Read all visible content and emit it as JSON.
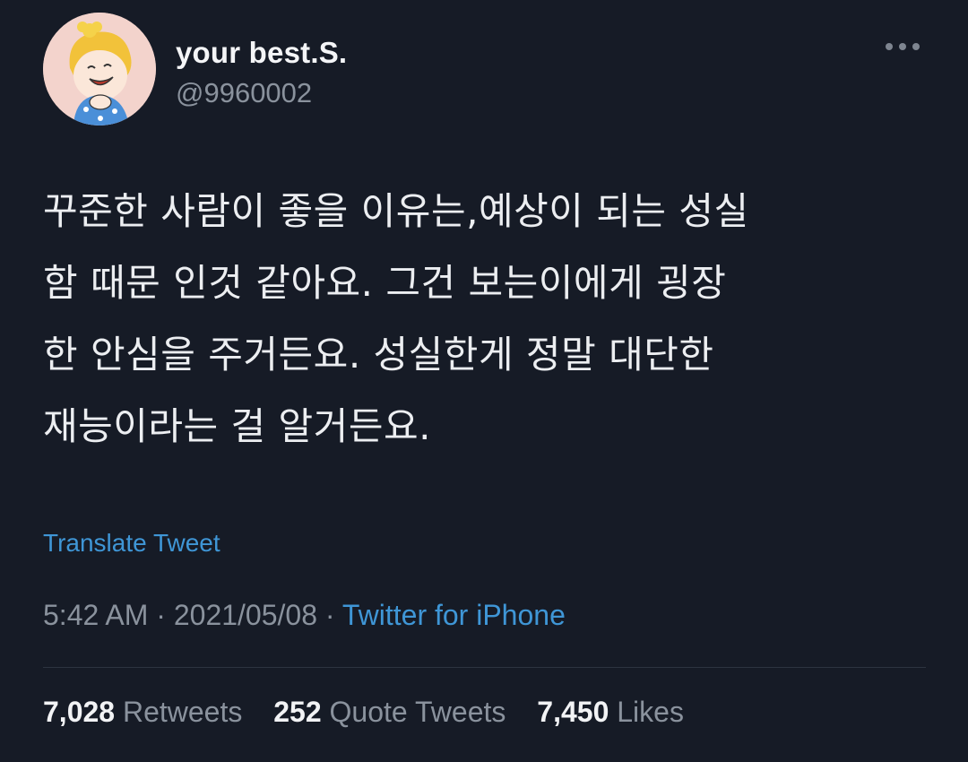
{
  "user": {
    "display_name": "your best.S.",
    "handle": "@9960002",
    "avatar_icon": "cartoon-girl-avatar"
  },
  "more_icon": "ellipsis-icon",
  "tweet": {
    "lines": [
      "꾸준한 사람이 좋을 이유는,예상이 되는 성실",
      "함 때문 인것 같아요. 그건 보는이에게 굉장",
      "한 안심을 주거든요. 성실한게 정말 대단한",
      "재능이라는 걸 알거든요."
    ],
    "translate_label": "Translate Tweet"
  },
  "meta": {
    "time": "5:42 AM",
    "separator": "·",
    "date": "2021/05/08",
    "source": "Twitter for iPhone"
  },
  "stats": {
    "retweets_count": "7,028",
    "retweets_label": "Retweets",
    "quotes_count": "252",
    "quotes_label": "Quote Tweets",
    "likes_count": "7,450",
    "likes_label": "Likes"
  },
  "colors": {
    "background": "#161b26",
    "link": "#3f96d6",
    "muted": "#8a929d"
  }
}
